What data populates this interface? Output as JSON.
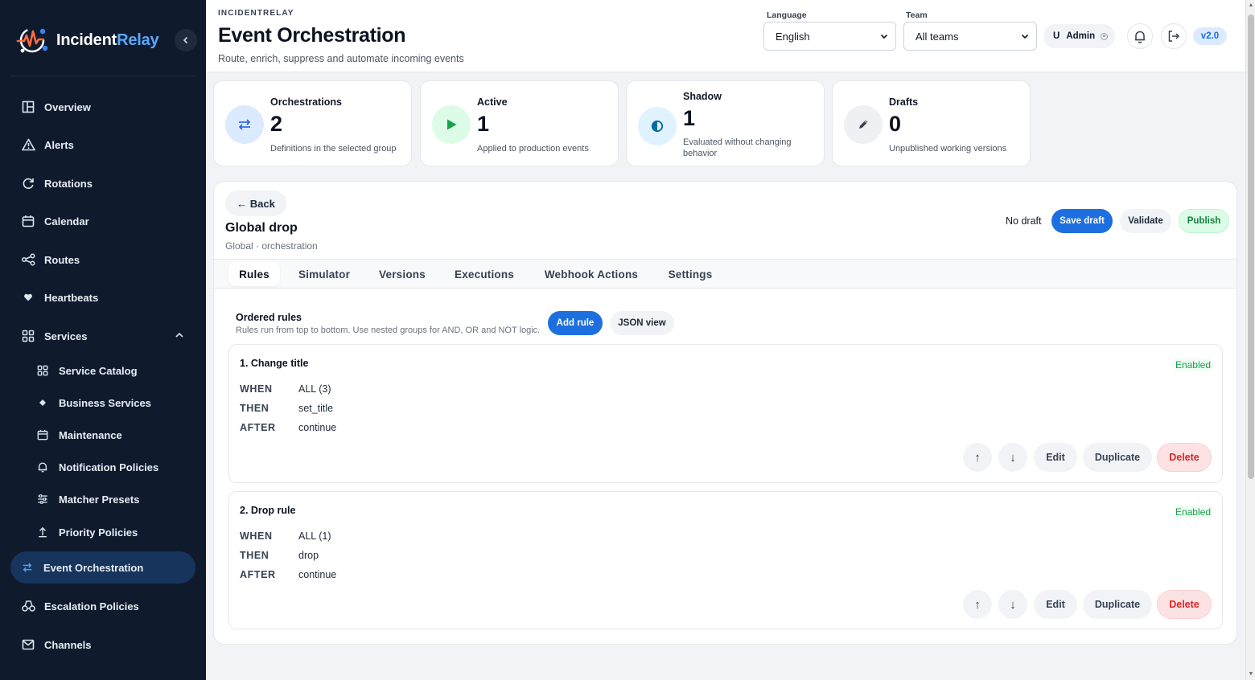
{
  "sidebar": {
    "brand": {
      "name_main": "Incident",
      "name_accent": "Relay"
    },
    "collapse_icon": "chevron-left-icon",
    "items": [
      {
        "label": "Overview",
        "icon": "layout-icon"
      },
      {
        "label": "Alerts",
        "icon": "warning-icon"
      },
      {
        "label": "Rotations",
        "icon": "refresh-icon"
      },
      {
        "label": "Calendar",
        "icon": "calendar-icon"
      },
      {
        "label": "Routes",
        "icon": "routes-icon"
      },
      {
        "label": "Heartbeats",
        "icon": "heart-icon"
      },
      {
        "label": "Services",
        "icon": "grid-icon",
        "expanded": true
      }
    ],
    "sub_items": [
      {
        "label": "Service Catalog",
        "icon": "grid-icon"
      },
      {
        "label": "Business Services",
        "icon": "diamond-icon"
      },
      {
        "label": "Maintenance",
        "icon": "calendar-icon"
      },
      {
        "label": "Notification Policies",
        "icon": "bell-icon"
      },
      {
        "label": "Matcher Presets",
        "icon": "sliders-icon"
      },
      {
        "label": "Priority Policies",
        "icon": "arrow-up-icon"
      }
    ],
    "items_after": [
      {
        "label": "Event Orchestration",
        "icon": "swap-icon",
        "active": true
      },
      {
        "label": "Escalation Policies",
        "icon": "escalation-icon"
      },
      {
        "label": "Channels",
        "icon": "mail-icon"
      }
    ]
  },
  "header": {
    "brand_small": "INCIDENTRELAY",
    "title": "Event Orchestration",
    "subtitle": "Route, enrich, suppress and automate incoming events",
    "language_label": "Language",
    "language_value": "English",
    "team_label": "Team",
    "team_value": "All teams",
    "user_initial": "U",
    "user_name": "Admin",
    "version": "v2.0"
  },
  "stats": [
    {
      "label": "Orchestrations",
      "value": "2",
      "desc": "Definitions in the selected group",
      "icon": "swap-icon",
      "color": "#dbeafe",
      "icon_color": "#2563eb"
    },
    {
      "label": "Active",
      "value": "1",
      "desc": "Applied to production events",
      "icon": "play-icon",
      "color": "#dcfce7",
      "icon_color": "#16a34a"
    },
    {
      "label": "Shadow",
      "value": "1",
      "desc": "Evaluated without changing behavior",
      "icon": "half-circle-icon",
      "color": "#e0f2fe",
      "icon_color": "#0369a1"
    },
    {
      "label": "Drafts",
      "value": "0",
      "desc": "Unpublished working versions",
      "icon": "pencil-icon",
      "color": "#eef0f3",
      "icon_color": "#374151"
    }
  ],
  "orchestration": {
    "back_label": "← Back",
    "title": "Global drop",
    "subtitle": "Global · orchestration",
    "draft_status": "No draft",
    "save_draft": "Save draft",
    "validate": "Validate",
    "publish": "Publish"
  },
  "tabs": [
    "Rules",
    "Simulator",
    "Versions",
    "Executions",
    "Webhook Actions",
    "Settings"
  ],
  "active_tab": "Rules",
  "rules_section": {
    "title": "Ordered rules",
    "subtitle": "Rules run from top to bottom. Use nested groups for AND, OR and NOT logic.",
    "add_rule": "Add rule",
    "json_view": "JSON view"
  },
  "rule_labels": {
    "when": "WHEN",
    "then": "THEN",
    "after": "AFTER",
    "edit": "Edit",
    "duplicate": "Duplicate",
    "delete": "Delete",
    "up": "↑",
    "down": "↓"
  },
  "rules": [
    {
      "title": "1. Change title",
      "status": "Enabled",
      "when": "ALL (3)",
      "then": "set_title",
      "after": "continue"
    },
    {
      "title": "2. Drop rule",
      "status": "Enabled",
      "when": "ALL (1)",
      "then": "drop",
      "after": "continue"
    }
  ],
  "colors": {
    "sidebar_bg": "#0f1b2d",
    "accent": "#1d6fe0",
    "enabled_green": "#16a34a",
    "danger": "#dc2626"
  }
}
